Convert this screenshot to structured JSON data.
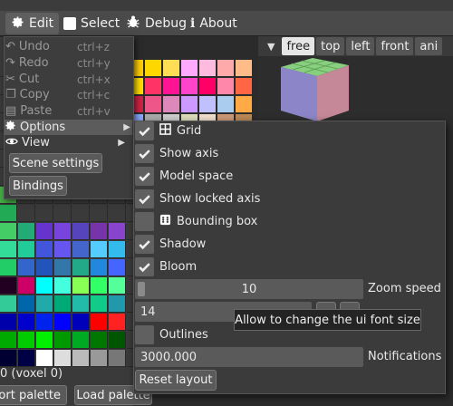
{
  "menubar": {
    "items": [
      {
        "label": "Edit",
        "icon": "gear-icon"
      },
      {
        "label": "Select",
        "icon": "checkbox-icon"
      },
      {
        "label": "Debug",
        "icon": "bug-icon"
      },
      {
        "label": "About",
        "icon": "info-icon"
      }
    ]
  },
  "view_tabs": [
    "free",
    "top",
    "left",
    "front",
    "ani"
  ],
  "edit_menu": {
    "items": [
      {
        "label": "Undo",
        "shortcut": "ctrl+z",
        "icon": "undo-icon",
        "enabled": false
      },
      {
        "label": "Redo",
        "shortcut": "ctrl+y",
        "icon": "redo-icon",
        "enabled": false
      },
      {
        "label": "Cut",
        "shortcut": "ctrl+x",
        "icon": "scissors-icon",
        "enabled": false
      },
      {
        "label": "Copy",
        "shortcut": "ctrl+c",
        "icon": "copy-icon",
        "enabled": false
      },
      {
        "label": "Paste",
        "shortcut": "ctrl+v",
        "icon": "paste-icon",
        "enabled": false
      },
      {
        "label": "Options",
        "icon": "gear-icon",
        "submenu": true
      },
      {
        "label": "View",
        "icon": "eye-icon",
        "submenu": true
      }
    ],
    "scene_settings": "Scene settings",
    "bindings": "Bindings"
  },
  "options": {
    "checks": [
      {
        "label": "Grid",
        "checked": true,
        "icon": "grid-icon"
      },
      {
        "label": "Show axis",
        "checked": true
      },
      {
        "label": "Model space",
        "checked": true
      },
      {
        "label": "Show locked axis",
        "checked": true
      },
      {
        "label": "Bounding box",
        "checked": false,
        "icon": "dice-icon"
      },
      {
        "label": "Shadow",
        "checked": true
      },
      {
        "label": "Bloom",
        "checked": true
      }
    ],
    "zoom_speed": {
      "value": "10",
      "label": "Zoom speed"
    },
    "font_size": {
      "value": "14"
    },
    "tooltip": "Allow to change the ui font size",
    "outlines": {
      "label": "Outlines",
      "checked": false
    },
    "notifications": {
      "value": "3000.000",
      "label": "Notifications"
    },
    "reset_layout": "Reset layout"
  },
  "palette": {
    "voxel_label": "0 (voxel 0)",
    "import_button": "Import palette",
    "load_button": "Load palette",
    "colors": [
      "#3a3a3a",
      "#3a3a3a",
      "#3a3a3a",
      "#3a3a3a",
      "#3a3a3a",
      "#3a3a3a",
      "#3a3a3a",
      "#ffcc00",
      "#ffd700",
      "#ffdd55",
      "#ffaaff",
      "#ffbbdd",
      "#ffaaaa",
      "#ffbb88",
      "#3a3a3a",
      "#3a3a3a",
      "#3a3a3a",
      "#3a3a3a",
      "#3a3a3a",
      "#3a3a3a",
      "#3a3a3a",
      "#ffdd00",
      "#ff3366",
      "#ff1493",
      "#ff44cc",
      "#ff0066",
      "#ff88aa",
      "#ff6644",
      "#3a3a3a",
      "#3a3a3a",
      "#3a3a3a",
      "#3a3a3a",
      "#3a3a3a",
      "#3a3a3a",
      "#3a3a3a",
      "#cc2244",
      "#ee5588",
      "#dd88bb",
      "#cc99ff",
      "#c0c0ff",
      "#aaccee",
      "#ffaa44",
      "#3a3a3a",
      "#3a3a3a",
      "#3a3a3a",
      "#3a3a3a",
      "#3a3a3a",
      "#3a3a3a",
      "#3a3a3a",
      "#88aaff",
      "#aaaaaa",
      "#cccccc",
      "#ddddbb",
      "#eeddcc",
      "#cc9977",
      "#bb8855",
      "#3a3a3a",
      "#3a3a3a",
      "#3a3a3a",
      "#3a3a3a",
      "#3a3a3a",
      "#3a3a3a",
      "#3a3a3a",
      "#3a3a3a",
      "#3a3a3a",
      "#3a3a3a",
      "#3a3a3a",
      "#3a3a3a",
      "#3a3a3a",
      "#3a3a3a",
      "#3a3a3a",
      "#3a3a3a",
      "#3a3a3a",
      "#3a3a3a",
      "#3a3a3a",
      "#3a3a3a",
      "#3a3a3a",
      "#3a3a3a",
      "#3a3a3a",
      "#3a3a3a",
      "#3a3a3a",
      "#3a3a3a",
      "#3a3a3a",
      "#3a3a3a",
      "#3a3a3a",
      "#3a3a3a",
      "#3a3a3a",
      "#3a3a3a",
      "#3a3a3a",
      "#3a3a3a",
      "#3a3a3a",
      "#3a3a3a",
      "#3a3a3a",
      "#3a3a3a",
      "#3a3a3a",
      "#3a3a3a",
      "#3a3a3a",
      "#3a3a3a",
      "#44aa44",
      "#3a3a3a",
      "#3a3a3a",
      "#3a3a3a",
      "#3a3a3a",
      "#3a3a3a",
      "#3a3a3a",
      "#3a3a3a",
      "#3a3a3a",
      "#3a3a3a",
      "#3a3a3a",
      "#3a3a3a",
      "#3a3a3a",
      "#3a3a3a",
      "#22aa55",
      "#3a3a3a",
      "#3a3a3a",
      "#3a3a3a",
      "#3a3a3a",
      "#3a3a3a",
      "#3a3a3a",
      "#3a3a3a",
      "#3a3a3a",
      "#3a3a3a",
      "#3a3a3a",
      "#3a3a3a",
      "#3a3a3a",
      "#3a3a3a",
      "#44cc66",
      "#22aa77",
      "#6633cc",
      "#7744dd",
      "#5544bb",
      "#7733aa",
      "#8844cc",
      "#3a3a3a",
      "#3a3a3a",
      "#3a3a3a",
      "#3a3a3a",
      "#3a3a3a",
      "#3a3a3a",
      "#3a3a3a",
      "#33dd99",
      "#22cc99",
      "#4455dd",
      "#6655ee",
      "#4466cc",
      "#55ccff",
      "#33bbee",
      "#3a3a3a",
      "#3a3a3a",
      "#3a3a3a",
      "#3a3a3a",
      "#3a3a3a",
      "#3a3a3a",
      "#3a3a3a",
      "#22cc66",
      "#3366cc",
      "#2255bb",
      "#3377aa",
      "#22aa88",
      "#2288dd",
      "#4466ff",
      "#3a3a3a",
      "#3a3a3a",
      "#3a3a3a",
      "#3a3a3a",
      "#3a3a3a",
      "#3a3a3a",
      "#3a3a3a",
      "#220022",
      "#cc0066",
      "#00ffff",
      "#44ffdd",
      "#88ff55",
      "#33ff66",
      "#55ff99",
      "#3a3a3a",
      "#3a3a3a",
      "#3a3a3a",
      "#3a3a3a",
      "#3a3a3a",
      "#3a3a3a",
      "#3a3a3a",
      "#33cc99",
      "#0066aa",
      "#22aaaa",
      "#00aa77",
      "#22bbaa",
      "#11cc88",
      "#2299aa",
      "#3a3a3a",
      "#3a3a3a",
      "#3a3a3a",
      "#3a3a3a",
      "#3a3a3a",
      "#3a3a3a",
      "#3a3a3a",
      "#0000aa",
      "#0000cc",
      "#0022ee",
      "#0000ff",
      "#0000bb",
      "#ff0000",
      "#ff2222",
      "#3a3a3a",
      "#3a3a3a",
      "#3a3a3a",
      "#3a3a3a",
      "#3a3a3a",
      "#3a3a3a",
      "#3a3a3a",
      "#00aa00",
      "#00cc00",
      "#00ee00",
      "#009900",
      "#00aa22",
      "#007700",
      "#005500",
      "#3a3a3a",
      "#3a3a3a",
      "#3a3a3a",
      "#3a3a3a",
      "#3a3a3a",
      "#3a3a3a",
      "#3a3a3a",
      "#000033",
      "#000044",
      "#ffffff",
      "#dddddd",
      "#bbbbbb",
      "#999999",
      "#777777",
      "#3a3a3a",
      "#3a3a3a",
      "#3a3a3a",
      "#3a3a3a",
      "#3a3a3a",
      "#3a3a3a",
      "#3a3a3a"
    ]
  }
}
